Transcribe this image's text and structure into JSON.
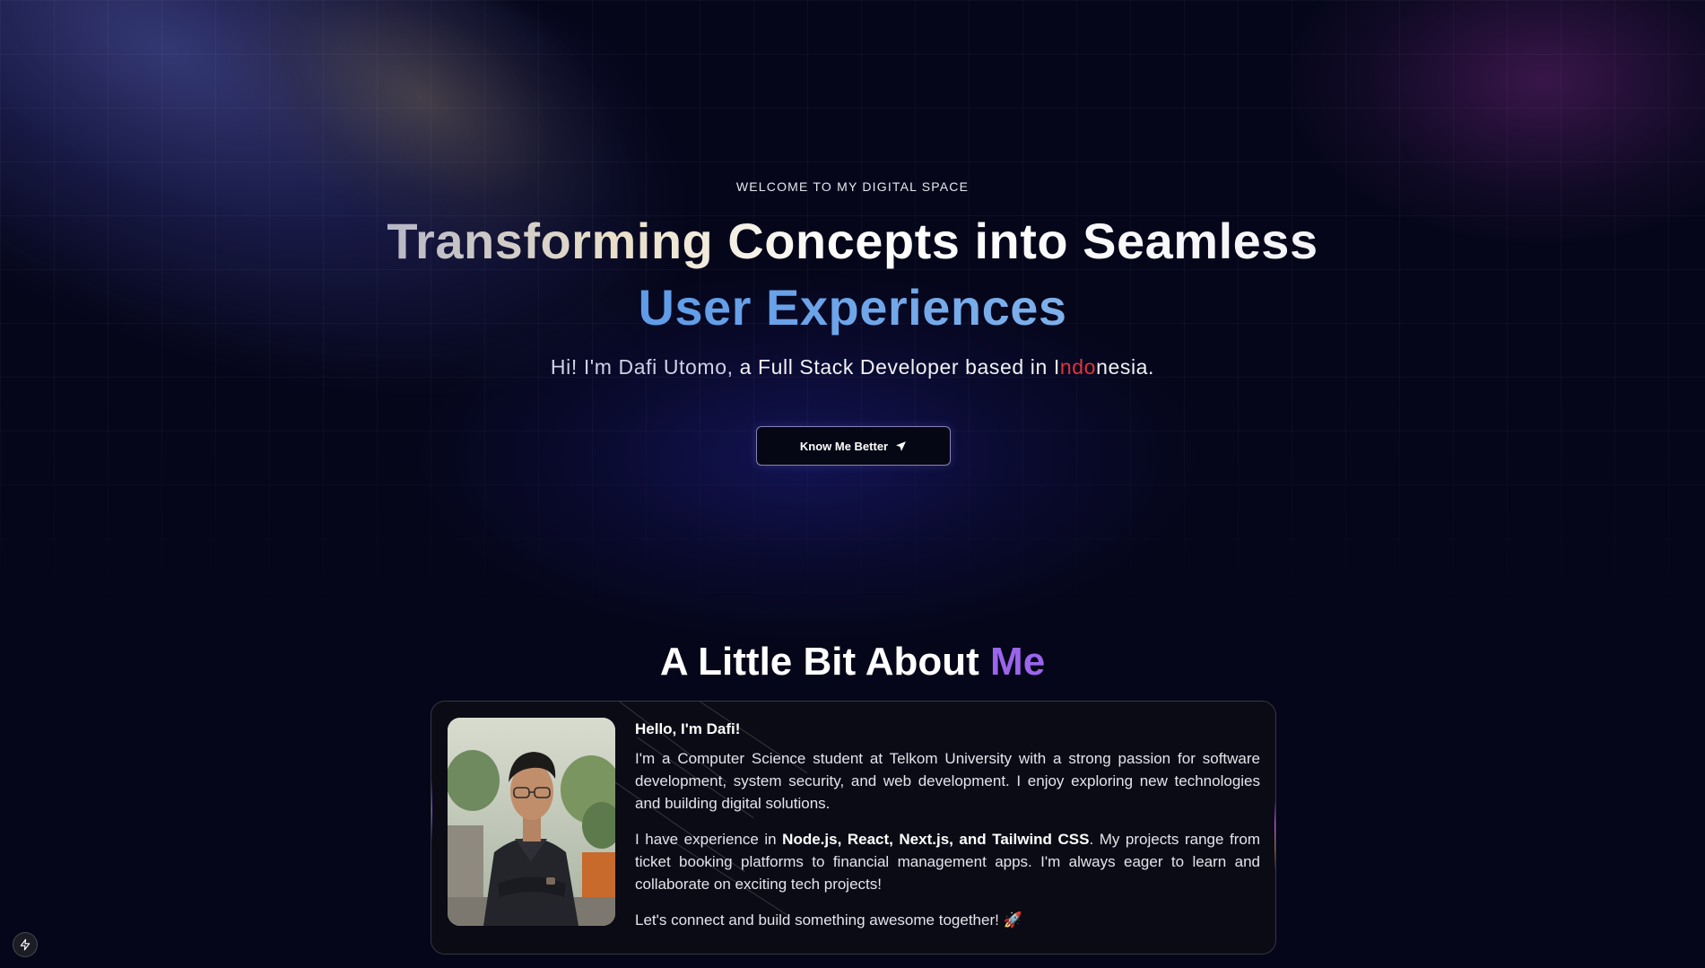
{
  "hero": {
    "eyebrow": "WELCOME TO MY DIGITAL SPACE",
    "headline_line1": "Transforming Concepts into Seamless",
    "headline_line2": "User Experiences",
    "subline": {
      "lead": "Hi! I'm Dafi Utomo,",
      "middle": " a Full Stack Developer based in ",
      "country_1": "I",
      "country_2": "ndo",
      "country_3": "nesia."
    },
    "cta_label": "Know Me Better",
    "cta_icon": "send-arrow-icon"
  },
  "about": {
    "title_main": "A Little Bit About ",
    "title_accent": "Me",
    "photo_icon": "profile-photo",
    "greeting": "Hello, I'm Dafi!",
    "para1": "I'm a Computer Science student at Telkom University with a strong passion for software development, system security, and web development. I enjoy exploring new technologies and building digital solutions.",
    "para2_start": "I have experience in ",
    "para2_bold": "Node.js, React, Next.js, and Tailwind CSS",
    "para2_end": ". My projects range from ticket booking platforms to financial management apps. I'm always eager to learn and collaborate on exciting tech projects!",
    "para3": "Let's connect and build something awesome together! 🚀"
  },
  "corner_badge_icon": "lightning-icon",
  "colors": {
    "background": "#05061a",
    "accent_blue": "#5e9be8",
    "accent_purple": "#9b65ec",
    "flag_red": "#e0343a"
  }
}
